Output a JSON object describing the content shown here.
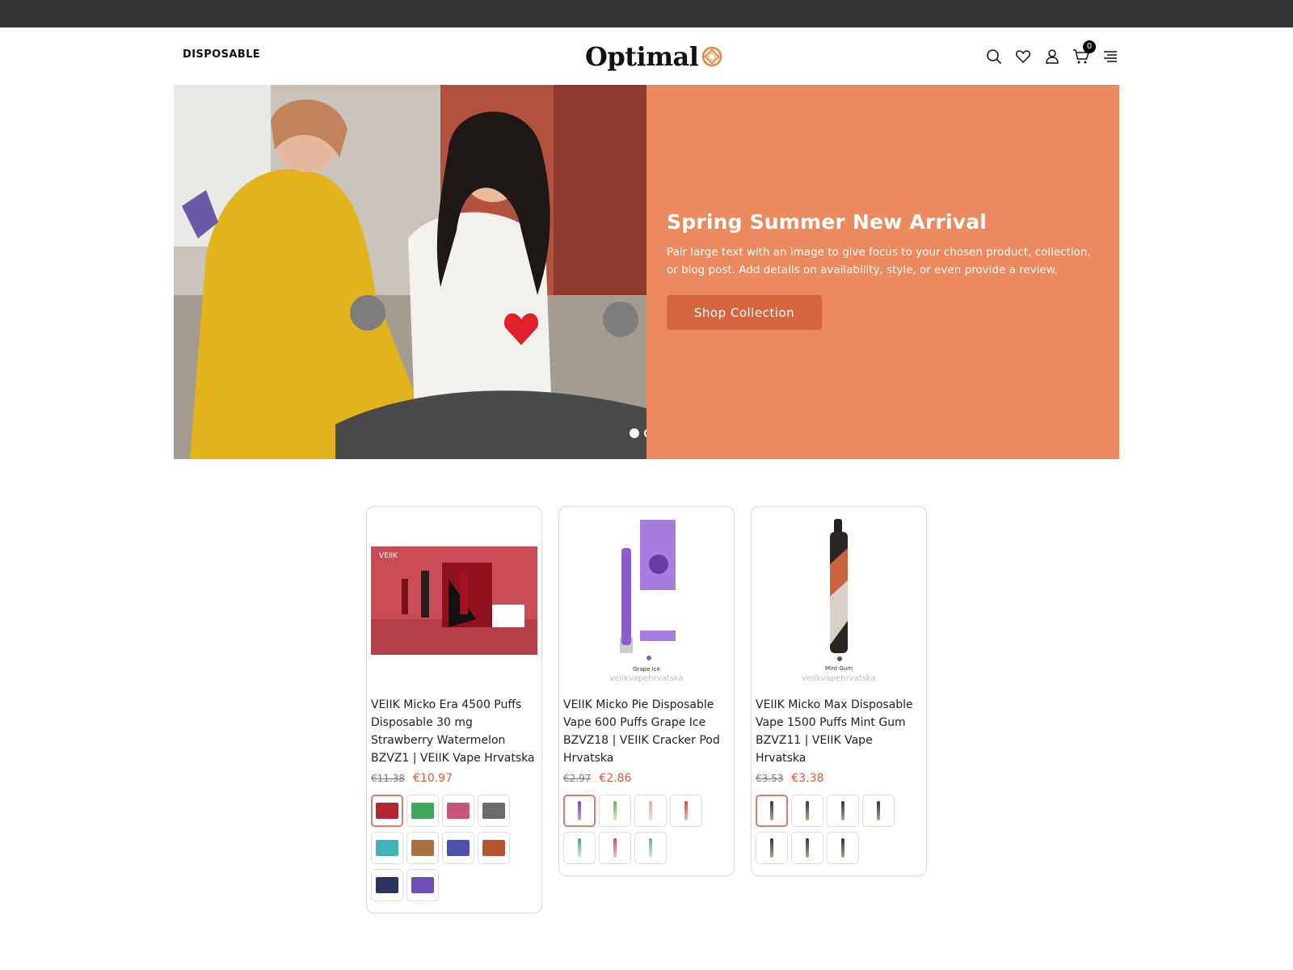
{
  "header": {
    "nav_link": "DISPOSABLE",
    "logo_text": "Optimal",
    "cart_count": "0"
  },
  "hero": {
    "title": "Spring Summer New Arrival",
    "text": "Pair large text with an image to give focus to your chosen product, collection, or blog post. Add details on availability, style, or even provide a review.",
    "button": "Shop Collection",
    "accent": "#ea8a5e",
    "button_color": "#d4653d",
    "slides": 2,
    "active_slide": 1
  },
  "products": [
    {
      "title": "VEIIK Micko Era 4500 Puffs Disposable 30 mg Strawberry Watermelon BZVZ1 | VEIIK Vape Hrvatska",
      "old_price": "€11.38",
      "price": "€10.97",
      "image_brand": "VEIIK",
      "swatch_count": 10
    },
    {
      "title": "VEIIK Micko Pie Disposable Vape 600 Puffs Grape Ice BZVZ18 | VEIIK Cracker Pod Hrvatska",
      "old_price": "€2.97",
      "price": "€2.86",
      "image_caption": "veiikvapehrvatska",
      "image_flavor": "Grape Ice",
      "swatch_count": 7
    },
    {
      "title": "VEIIK Micko Max Disposable Vape 1500 Puffs Mint Gum BZVZ11 | VEIIK Vape Hrvatska",
      "old_price": "€3.53",
      "price": "€3.38",
      "image_caption": "veiikvapehrvatska",
      "image_flavor": "Mint Gum",
      "swatch_count": 7
    }
  ]
}
